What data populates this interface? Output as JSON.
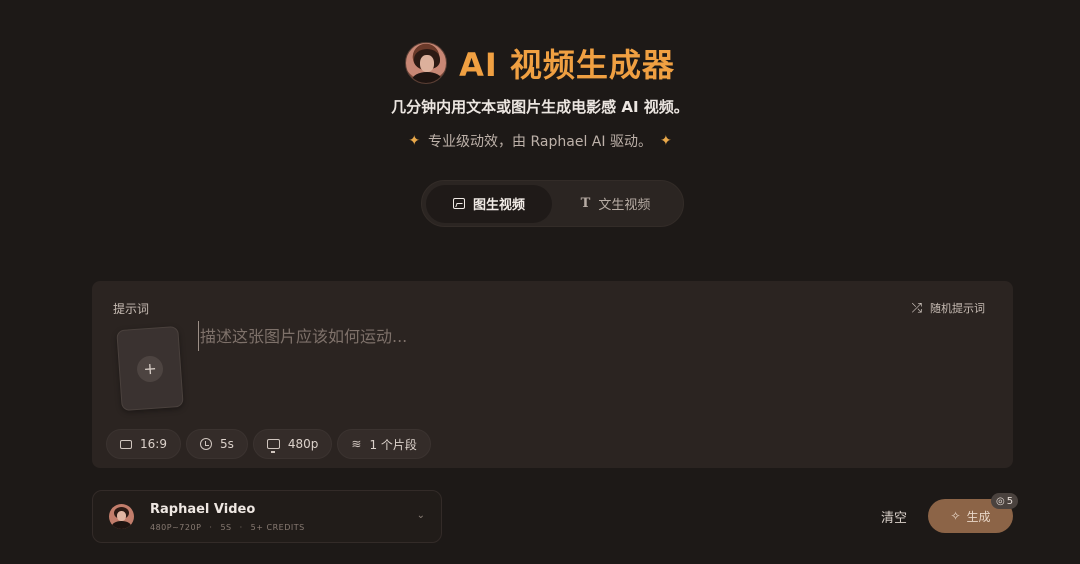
{
  "header": {
    "title": "AI 视频生成器",
    "subtitle": "几分钟内用文本或图片生成电影感 AI 视频。",
    "tagline": "专业级动效，由 Raphael AI 驱动。"
  },
  "modes": [
    {
      "label": "图生视频",
      "icon": "image-icon",
      "active": true
    },
    {
      "label": "文生视频",
      "icon": "text-icon",
      "active": false
    }
  ],
  "prompt": {
    "label": "提示词",
    "random_label": "随机提示词",
    "placeholder": "描述这张图片应该如何运动...",
    "value": ""
  },
  "options": {
    "aspect_ratio": "16:9",
    "duration": "5s",
    "resolution": "480p",
    "segments": "1 个片段"
  },
  "model": {
    "name": "Raphael Video",
    "meta": [
      "480P~720P",
      "5S",
      "5+ CREDITS"
    ],
    "meta_sep": "·"
  },
  "actions": {
    "clear_label": "清空",
    "generate_label": "生成",
    "credit_cost": "5"
  },
  "colors": {
    "background": "#1d1917",
    "accent": "#f0a042",
    "generate_button": "#8c6447"
  }
}
